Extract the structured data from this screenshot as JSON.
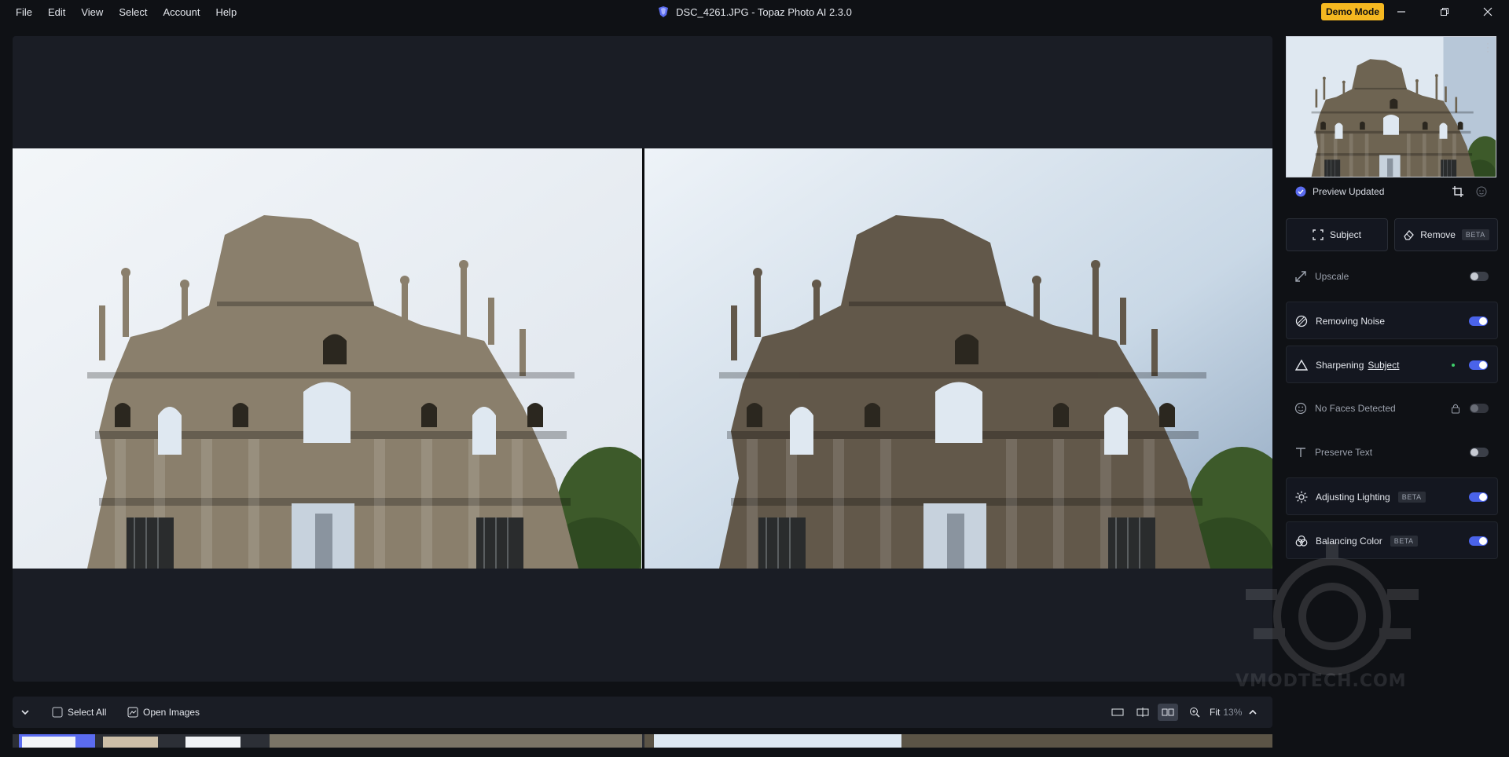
{
  "menu": [
    "File",
    "Edit",
    "View",
    "Select",
    "Account",
    "Help"
  ],
  "window": {
    "title": "DSC_4261.JPG - Topaz Photo AI 2.3.0",
    "demo_label": "Demo Mode"
  },
  "bottom_bar": {
    "select_all": "Select All",
    "open_images": "Open Images",
    "zoom_prefix": "Fit",
    "zoom_value": "13%"
  },
  "panel": {
    "preview_status": "Preview Updated",
    "subject_button": "Subject",
    "remove_button": "Remove",
    "beta": "BETA",
    "rows": [
      {
        "label": "Upscale",
        "state": "off"
      },
      {
        "label": "Removing Noise",
        "state": "on"
      },
      {
        "label": "Sharpening",
        "link": "Subject",
        "state": "on"
      },
      {
        "label": "No Faces Detected",
        "state": "disabled"
      },
      {
        "label": "Preserve Text",
        "state": "off"
      },
      {
        "label": "Adjusting Lighting",
        "badge": "BETA",
        "state": "on"
      },
      {
        "label": "Balancing Color",
        "badge": "BETA",
        "state": "on"
      }
    ]
  },
  "watermark": "VMODTECH.COM",
  "colors": {
    "accent": "#4a63ea",
    "demo": "#f5b820",
    "status_green": "#3ecf6a"
  }
}
